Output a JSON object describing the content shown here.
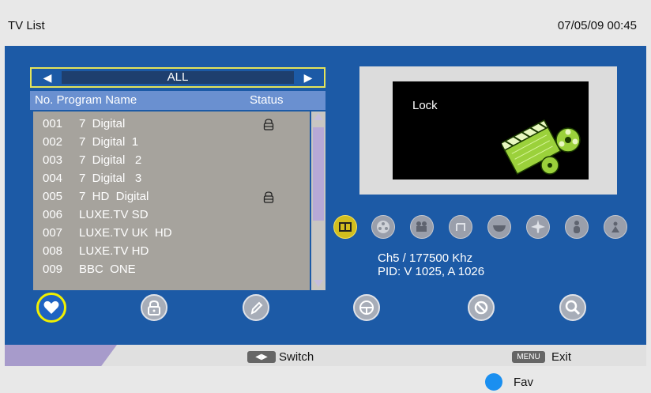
{
  "header": {
    "title": "TV List",
    "datetime": "07/05/09 00:45"
  },
  "category": {
    "name": "ALL"
  },
  "list": {
    "col_program": "No. Program Name",
    "col_status": "Status",
    "rows": [
      {
        "num": "001",
        "name": "7  Digital",
        "locked": true
      },
      {
        "num": "002",
        "name": "7  Digital  1",
        "locked": false
      },
      {
        "num": "003",
        "name": "7  Digital   2",
        "locked": false
      },
      {
        "num": "004",
        "name": "7  Digital   3",
        "locked": false
      },
      {
        "num": "005",
        "name": "7  HD  Digital",
        "locked": true
      },
      {
        "num": "006",
        "name": "LUXE.TV SD",
        "locked": false
      },
      {
        "num": "007",
        "name": "LUXE.TV UK  HD",
        "locked": false
      },
      {
        "num": "008",
        "name": "LUXE.TV HD",
        "locked": false
      },
      {
        "num": "009",
        "name": "BBC  ONE",
        "locked": false
      }
    ]
  },
  "preview": {
    "message": "Lock"
  },
  "genre_icons": [
    "tv-icon",
    "film-reel-icon",
    "news-camera-icon",
    "music-icon",
    "bowl-icon",
    "airplane-icon",
    "person-icon",
    "person-small-icon"
  ],
  "info": {
    "frequency": "Ch5 / 177500  Khz",
    "pid": "PID: V 1025, A 1026"
  },
  "actions": [
    "favorite-icon",
    "lock-icon",
    "edit-icon",
    "skip-icon",
    "delete-icon",
    "find-icon"
  ],
  "footer": {
    "switch_label": "Switch",
    "menu_key": "MENU",
    "exit_label": "Exit",
    "fav_label": "Fav"
  },
  "colors": {
    "background": "#1c5aa6",
    "highlight": "#e4e45a",
    "list_bg": "#a6a39d",
    "header_bar": "#6a90d0",
    "fav_button": "#1a8ff0"
  }
}
